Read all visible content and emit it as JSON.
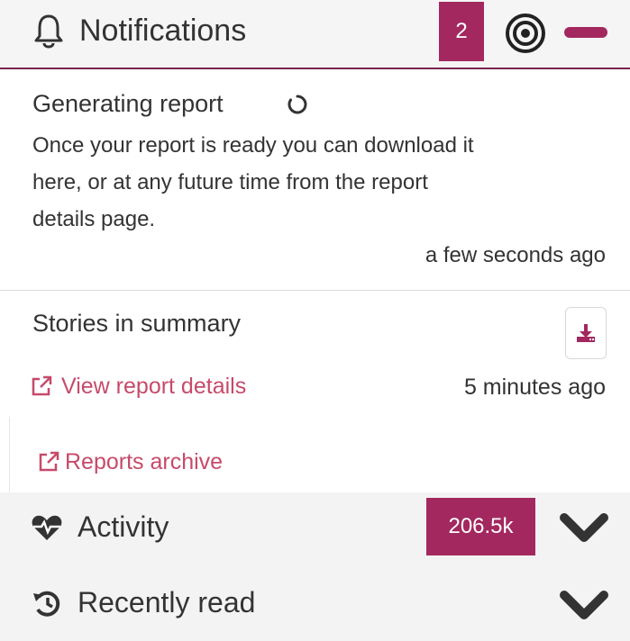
{
  "header": {
    "title": "Notifications",
    "count": "2",
    "icons": [
      "bell-icon",
      "target-icon",
      "minimize-icon"
    ]
  },
  "notifications": [
    {
      "heading": "Generating report",
      "body_lines": [
        "Once your report is ready you can download it",
        "here, or at any future time from the report",
        "details page."
      ],
      "time": "a few seconds ago"
    },
    {
      "heading": "Stories in summary",
      "link": "View report details",
      "time": "5 minutes ago"
    }
  ],
  "archive": {
    "link": "Reports archive"
  },
  "sections": {
    "activity": {
      "label": "Activity",
      "count": "206.5k"
    },
    "recent": {
      "label": "Recently read"
    }
  },
  "colors": {
    "accent": "#a3285f",
    "link": "#c74a6a",
    "section_bg": "#f3f3f3"
  }
}
